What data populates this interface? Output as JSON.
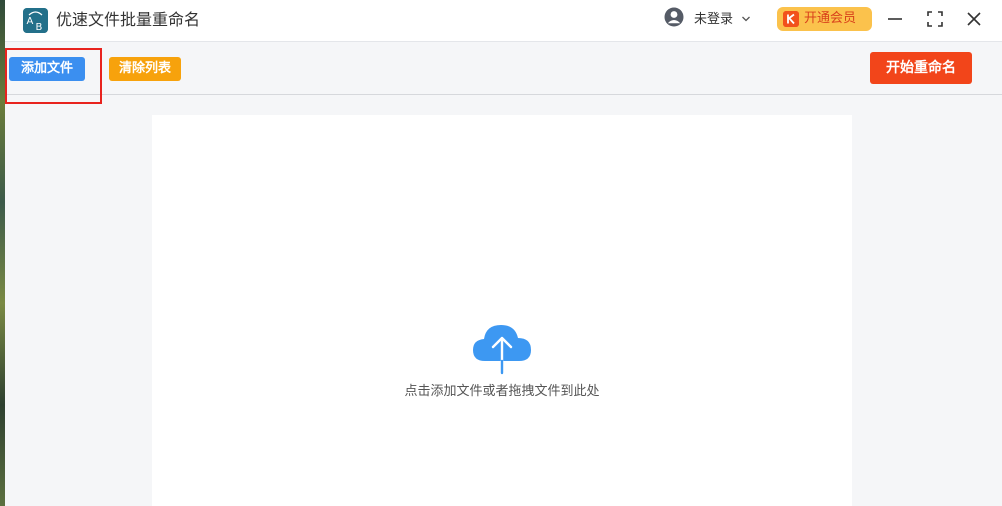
{
  "app": {
    "title": "优速文件批量重命名",
    "logo_text": "AB"
  },
  "header": {
    "login_label": "未登录",
    "vip_label": "开通会员"
  },
  "toolbar": {
    "add_label": "添加文件",
    "clear_label": "清除列表",
    "start_label": "开始重命名"
  },
  "drop_area": {
    "hint": "点击添加文件或者拖拽文件到此处"
  },
  "colors": {
    "primary_blue": "#3b8ff0",
    "clear_orange": "#f7a20c",
    "start_red": "#f2451a",
    "vip_yellow": "#fbc24c",
    "highlight_red": "#e8231e"
  }
}
